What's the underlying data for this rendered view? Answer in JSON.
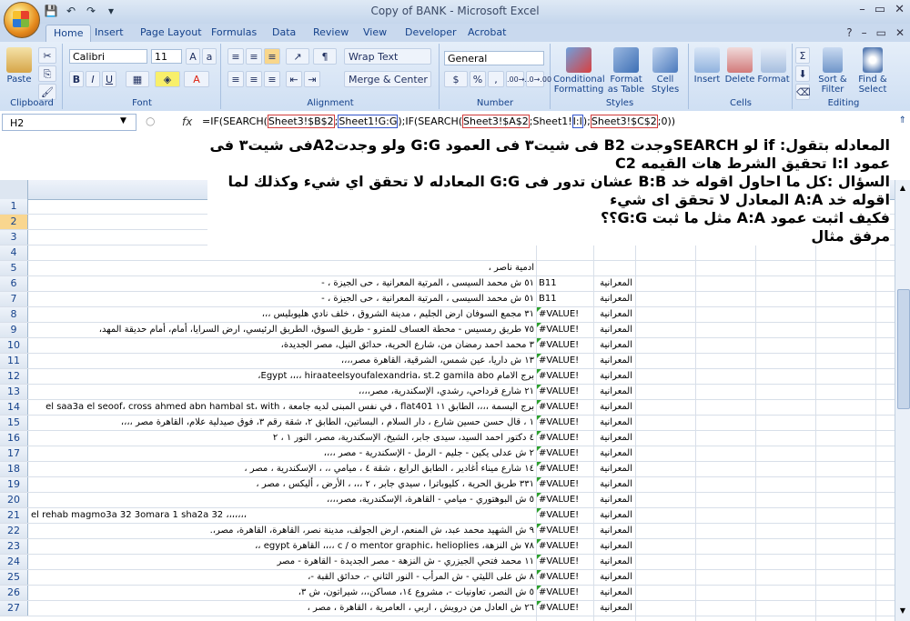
{
  "window": {
    "title": "Copy of BANK - Microsoft Excel",
    "minimize": "–",
    "restore": "▭",
    "close": "✕"
  },
  "qat_icons": [
    "save-icon",
    "undo-icon",
    "redo-icon"
  ],
  "tabs": [
    "Home",
    "Insert",
    "Page Layout",
    "Formulas",
    "Data",
    "Review",
    "View",
    "Developer",
    "Acrobat"
  ],
  "ribbon": {
    "clipboard": {
      "label": "Clipboard",
      "paste": "Paste"
    },
    "font": {
      "label": "Font",
      "name": "Calibri",
      "size": "11",
      "bold": "B",
      "italic": "I",
      "underline": "U"
    },
    "alignment": {
      "label": "Alignment",
      "wrap": "Wrap Text",
      "merge": "Merge & Center"
    },
    "number": {
      "label": "Number",
      "format": "General",
      "pct": "%",
      "comma": ",",
      "inc": ".00→.0",
      "dec": ".0→.00"
    },
    "styles": {
      "label": "Styles",
      "conditional": "Conditional Formatting",
      "table": "Format as Table",
      "cell": "Cell Styles"
    },
    "cells": {
      "label": "Cells",
      "insert": "Insert",
      "delete": "Delete",
      "format": "Format"
    },
    "editing": {
      "label": "Editing",
      "sort": "Sort & Filter",
      "find": "Find & Select"
    }
  },
  "formula_bar": {
    "name_box": "H2",
    "fx": "fx",
    "parts": [
      {
        "t": "=IF(SEARCH(",
        "c": ""
      },
      {
        "t": "Sheet3!$B$2",
        "c": "r"
      },
      {
        "t": ";",
        "c": ""
      },
      {
        "t": "Sheet1!G:G",
        "c": "b"
      },
      {
        "t": ");IF(SEARCH(",
        "c": ""
      },
      {
        "t": "Sheet3!$A$2",
        "c": "r"
      },
      {
        "t": ";Sheet1!",
        "c": ""
      },
      {
        "t": "I:I",
        "c": "b"
      },
      {
        "t": ");",
        "c": ""
      },
      {
        "t": "Sheet3!$C$2",
        "c": "r"
      },
      {
        "t": ";0))",
        "c": ""
      }
    ]
  },
  "note_lines": [
    "المعادله بتقول: if لو SEARCHوجدت B2 فى شيت٣ فى العمود G:G ولو وجدتA2فى شيت٣ فى",
    "عمود I:I تحقيق الشرط هات القيمه C2",
    "السؤال :كل ما احاول اقوله خد B:B عشان تدور فى G:G المعادله لا تحقق اي شيء وكذلك لما",
    "اقوله خد A:A المعادل لا تحقق اى شيء",
    "فكيف اثبت عمود A:A مثل ما ثبت G:G؟؟",
    "مرفق مثال"
  ],
  "rows": [
    {
      "n": "1",
      "a": "",
      "b": "",
      "c": ""
    },
    {
      "n": "2",
      "a": "",
      "b": "",
      "c": "",
      "sel": true
    },
    {
      "n": "3",
      "a": "",
      "b": "",
      "c": ""
    },
    {
      "n": "4",
      "a": "",
      "b": "",
      "c": ""
    },
    {
      "n": "5",
      "a": "ادمية ناصر ،",
      "b": "",
      "c": ""
    },
    {
      "n": "6",
      "a": "٥١ ش محمد السيسى ، المرتية المعرانية ، حى الجيزة ، -",
      "b": "B11",
      "c": "المعرانية"
    },
    {
      "n": "7",
      "a": "٥١ ش محمد السيسى ، المرتية المعرانية ، حى الجيزة ، -",
      "b": "B11",
      "c": "المعرانية"
    },
    {
      "n": "8",
      "a": "٣١ مجمع السوفان ارض الجليم ، مدينة الشروق ، خلف نادي هليوبليس ،،،",
      "b": "#VALUE!",
      "c": "المعرانية"
    },
    {
      "n": "9",
      "a": "٧٥ طريق رمسيس - محطة العساف للمترو - طريق السوق، الطريق الرئيسي، ارض السرايا، أمام، أمام حديقة المهد،",
      "b": "#VALUE!",
      "c": "المعرانية"
    },
    {
      "n": "10",
      "a": "٣ محمد احمد رمضان من، شارع الحرية، حدائق النيل، مصر الجديدة،",
      "b": "#VALUE!",
      "c": "المعرانية"
    },
    {
      "n": "11",
      "a": "١٣ ش داريا، عين شمس، الشرقية، القاهرة مصر،،،،",
      "b": "#VALUE!",
      "c": "المعرانية"
    },
    {
      "n": "12",
      "a": "برج الامام Egypt ،،،، hiraateelsyoufalexandria، st.2 gamila abo،",
      "b": "#VALUE!",
      "c": "المعرانية"
    },
    {
      "n": "13",
      "a": "٢١ شارع قرداحي، رشدي، الإسكندرية، مصر،،،،",
      "b": "#VALUE!",
      "c": "المعرانية"
    },
    {
      "n": "14",
      "a": "برج البسمة ،،،، الطابق ١١ flat401 ، في نفس المبنى لديه جامعة ، el saa3a el seoof، cross ahmed abn hambal st، with",
      "b": "#VALUE!",
      "c": "المعرانية"
    },
    {
      "n": "15",
      "a": "١ ، قال حسن حسين شارع ، دار السلام ، البساتين، الطابق ٢، شقة رقم ٣، فوق صيدلية علام، القاهرة مصر ،،،،",
      "b": "#VALUE!",
      "c": "المعرانية"
    },
    {
      "n": "16",
      "a": "٤ دكتور احمد السيد، سيدى جابر، الشيخ، الإسكندرية، مصر، النور ١ ، ٢",
      "b": "#VALUE!",
      "c": "المعرانية"
    },
    {
      "n": "17",
      "a": "٢ ش عدلى يكين - جليم - الرمل - الإسكندرية - مصر ،،،،",
      "b": "#VALUE!",
      "c": "المعرانية"
    },
    {
      "n": "18",
      "a": "١٤ شارع ميناء أغادير ، الطابق الرابع ، شقة ٤ ، ميامي ،، ، الإسكندرية ، مصر ،",
      "b": "#VALUE!",
      "c": "المعرانية"
    },
    {
      "n": "19",
      "a": "٣٣١ طريق الحرية ، كليوباترا ، سيدي جابر ، ٢ ،،، ، الأرض ، أليكس ، مصر ،",
      "b": "#VALUE!",
      "c": "المعرانية"
    },
    {
      "n": "20",
      "a": "٥ ش البوهتوري - ميامي - القاهرة، الإسكندرية، مصر،،،،",
      "b": "#VALUE!",
      "c": "المعرانية"
    },
    {
      "n": "21",
      "a": "el rehab magmo3a 32 3omara 1 sha2a 32 ،،،،،،،",
      "b": "#VALUE!",
      "c": "المعرانية"
    },
    {
      "n": "22",
      "a": "٩ ش الشهيد محمد عبد، ش المنعم، ارض الجولف، مدينة نصر، القاهرة، القاهرة، مصر،.",
      "b": "#VALUE!",
      "c": "المعرانية"
    },
    {
      "n": "23",
      "a": "٧٨ ش النزهة، c / o mentor graphic، helioplies ،،،، القاهرة egypt ،،",
      "b": "#VALUE!",
      "c": "المعرانية"
    },
    {
      "n": "24",
      "a": "١١ محمد فتحي الجيزري - ش النزهة - مصر الجديدة - القاهرة - مصر",
      "b": "#VALUE!",
      "c": "المعرانية"
    },
    {
      "n": "25",
      "a": "٨ ش على الليثي - ش المرأب - النور الثاني -، حدائق القبة -،",
      "b": "#VALUE!",
      "c": "المعرانية"
    },
    {
      "n": "26",
      "a": "٥ ش النصر، تعاونيات -، مشروع ١٤، مساكن،،، شيراتون، ش ٣،",
      "b": "#VALUE!",
      "c": "المعرانية"
    },
    {
      "n": "27",
      "a": "٢٦ ش العادل من درويش ، اربي ، العامرية ، القاهرة ، مصر ،",
      "b": "#VALUE!",
      "c": "المعرانية"
    }
  ]
}
